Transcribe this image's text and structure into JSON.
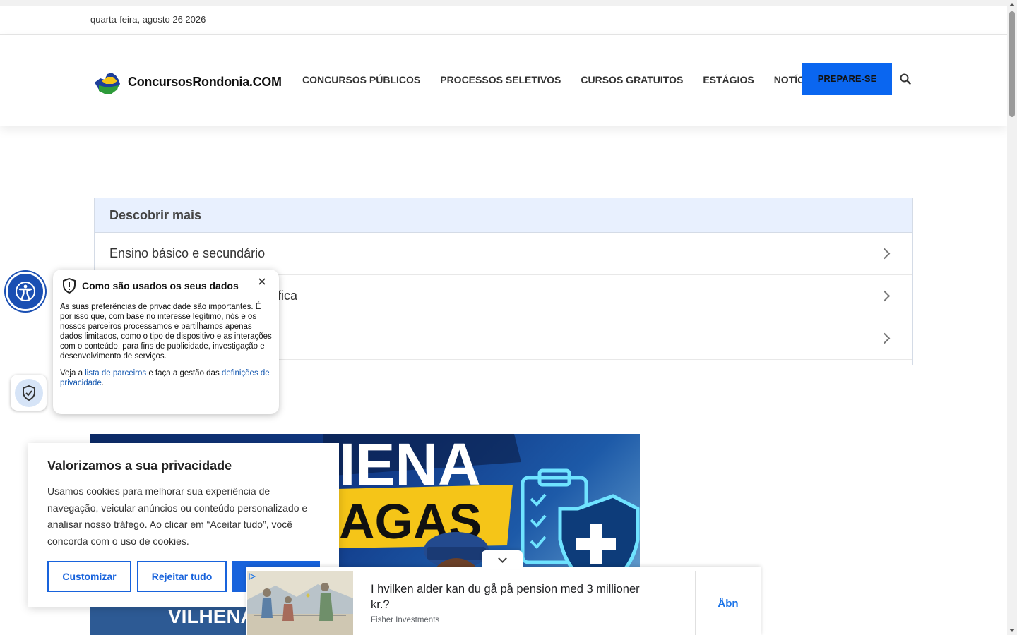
{
  "topbar": {
    "date": "quarta-feira, agosto 26 2026"
  },
  "header": {
    "logo_text": "ConcursosRondonia.COM",
    "nav": [
      {
        "label": "CONCURSOS PÚBLICOS"
      },
      {
        "label": "PROCESSOS SELETIVOS"
      },
      {
        "label": "CURSOS GRATUITOS"
      },
      {
        "label": "ESTÁGIOS"
      },
      {
        "label": "NOTÍCIAS"
      }
    ],
    "cta_label": "PREPARE-SE"
  },
  "discover": {
    "title": "Descobrir mais",
    "items": [
      {
        "label": "Ensino básico e secundário"
      },
      {
        "label": "fica"
      },
      {
        "label": ""
      }
    ]
  },
  "privacy_popup": {
    "title": "Como são usados os seus dados",
    "body": "As suas preferências de privacidade são importantes. É por isso que, com base no interesse legítimo, nós e os nossos parceiros processamos e partilhamos apenas dados limitados, como o tipo de dispositivo e as interações com o conteúdo, para fins de publicidade, investigação e desenvolvimento de serviços.",
    "links_prefix": "Veja a",
    "partners_link": "lista de parceiros",
    "links_middle": "e faça a gestão das",
    "settings_link": "definições de privacidade",
    "links_suffix": "."
  },
  "cookie_banner": {
    "title": "Valorizamos a sua privacidade",
    "text": "Usamos cookies para melhorar sua experiência de navegação, veicular anúncios ou conteúdo personalizado e analisar nosso tráfego. Ao clicar em “Aceitar tudo”, você concorda com o uso de cookies.",
    "customize_label": "Customizar",
    "reject_label": "Rejeitar tudo",
    "accept_label": ""
  },
  "ad": {
    "headline": "I hvilken alder kan du gå på pension med 3 millioner kr.?",
    "source": "Fisher Investments",
    "open_label": "Åbn"
  },
  "article_image": {
    "text_top": "IENA",
    "text_mid": "AGAS",
    "text_bottom": "VILHENA"
  },
  "colors": {
    "accent": "#0a66f0",
    "cookie_blue": "#1863dc",
    "discover_header_bg": "#e8f0fe",
    "accessibility_blue": "#1a4fb3"
  },
  "icons": {
    "search": "search-icon",
    "accessibility": "accessibility-icon",
    "shield": "shield-icon",
    "close": "close-icon",
    "chevron": "chevron-right-icon"
  }
}
